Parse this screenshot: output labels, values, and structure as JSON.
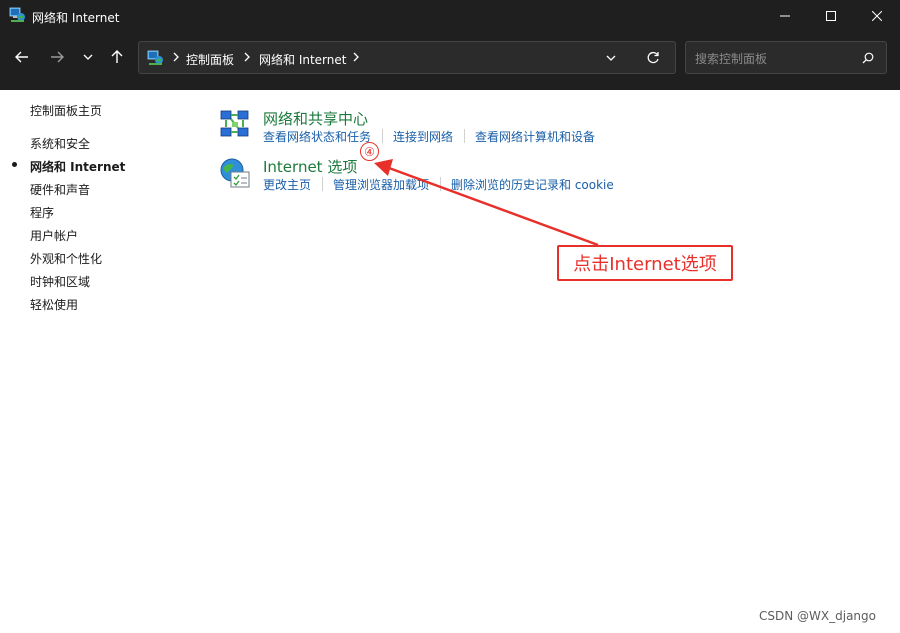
{
  "window": {
    "title": "网络和 Internet"
  },
  "navigation": {
    "breadcrumbs": [
      "控制面板",
      "网络和 Internet"
    ],
    "search_placeholder": "搜索控制面板"
  },
  "left_nav": {
    "items": [
      {
        "label": "控制面板主页"
      },
      {
        "label": "系统和安全"
      },
      {
        "label": "网络和 Internet",
        "active": true
      },
      {
        "label": "硬件和声音"
      },
      {
        "label": "程序"
      },
      {
        "label": "用户帐户"
      },
      {
        "label": "外观和个性化"
      },
      {
        "label": "时钟和区域"
      },
      {
        "label": "轻松使用"
      }
    ]
  },
  "categories": [
    {
      "icon": "network-sharing-center-icon",
      "title": "网络和共享中心",
      "links": [
        "查看网络状态和任务",
        "连接到网络",
        "查看网络计算机和设备"
      ]
    },
    {
      "icon": "internet-options-icon",
      "title": "Internet 选项",
      "links": [
        "更改主页",
        "管理浏览器加载项",
        "删除浏览的历史记录和 cookie"
      ]
    }
  ],
  "annotation": {
    "step_number": "④",
    "callout_text": "点击Internet选项",
    "color": "#e8302a"
  },
  "watermark": "CSDN @WX_django",
  "colors": {
    "title_bar": "#1f1f1f",
    "category_title": "#1c7a3c",
    "link": "#1a5fa8"
  }
}
